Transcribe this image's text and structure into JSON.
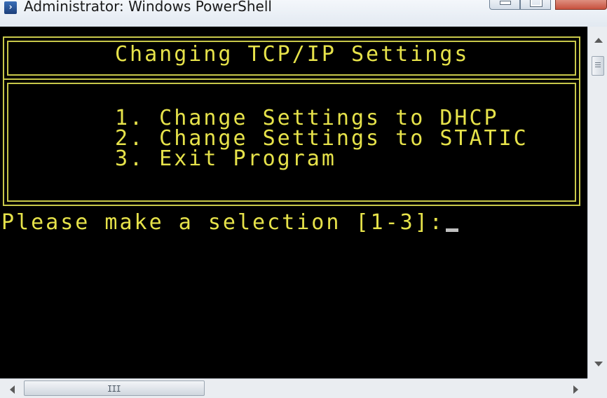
{
  "window": {
    "title": "Administrator: Windows PowerShell",
    "icon": "powershell-icon",
    "icon_glyph": "›"
  },
  "console": {
    "heading": "Changing TCP/IP Settings",
    "menu_items": [
      "1. Change Settings to DHCP",
      "2. Change Settings to STATIC",
      "3. Exit Program"
    ],
    "prompt": "Please make a selection [1-3]:",
    "text_color": "#e6e24a",
    "background_color": "#000000"
  },
  "scrollbar": {
    "h_grip_glyph": "III"
  }
}
